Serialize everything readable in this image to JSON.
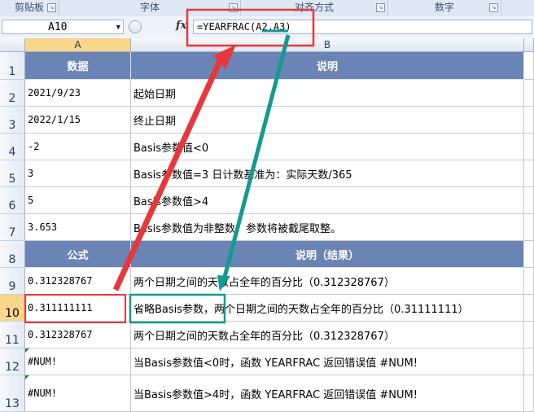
{
  "ribbon": {
    "groups": [
      {
        "label": "剪贴板"
      },
      {
        "label": "字体"
      },
      {
        "label": "对齐方式"
      },
      {
        "label": "数字"
      }
    ]
  },
  "formula_bar": {
    "name_box": "A10",
    "fx": "fx",
    "formula": "=YEARFRAC(A2,A3)"
  },
  "columns": [
    "A",
    "B"
  ],
  "rows": [
    {
      "num": "1",
      "a": "数据",
      "b": "说明",
      "header": true
    },
    {
      "num": "2",
      "a": "2021/9/23",
      "b": "起始日期"
    },
    {
      "num": "3",
      "a": "2022/1/15",
      "b": "终止日期"
    },
    {
      "num": "4",
      "a": "-2",
      "b": "Basis参数值<0"
    },
    {
      "num": "5",
      "a": "3",
      "b": "Basis参数值=3   日计数基准为：实际天数/365"
    },
    {
      "num": "6",
      "a": "5",
      "b": "Basis参数值>4"
    },
    {
      "num": "7",
      "a": "3.653",
      "b": "Basis参数值为非整数，参数将被截尾取整。"
    },
    {
      "num": "8",
      "a": "公式",
      "b": "说明（结果）",
      "header": true
    },
    {
      "num": "9",
      "a": "0.312328767",
      "b": "两个日期之间的天数占全年的百分比（0.312328767）"
    },
    {
      "num": "10",
      "a": "0.311111111",
      "b": "省略Basis参数，两个日期之间的天数占全年的百分比（0.31111111）"
    },
    {
      "num": "11",
      "a": "0.312328767",
      "b": "两个日期之间的天数占全年的百分比（0.312328767）"
    },
    {
      "num": "12",
      "a": "#NUM!",
      "b": "当Basis参数值<0时，函数 YEARFRAC 返回错误值 #NUM!"
    },
    {
      "num": "13",
      "a": "#NUM!",
      "b": "当Basis参数值>4时，函数 YEARFRAC 返回错误值 #NUM!"
    }
  ],
  "colors": {
    "header_fill": "#6a84b5",
    "highlight_red": "#e8373a",
    "highlight_teal": "#139a92"
  }
}
